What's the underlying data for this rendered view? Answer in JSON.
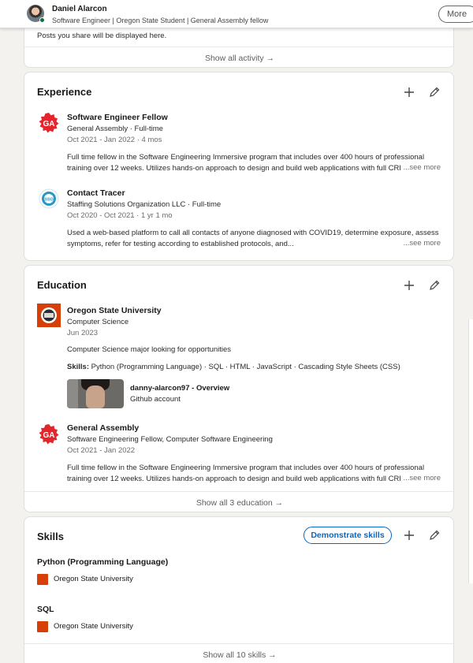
{
  "header": {
    "name": "Daniel Alarcon",
    "headline": "Software Engineer | Oregon State Student | General Assembly fellow",
    "more_label": "More"
  },
  "activity": {
    "empty_text": "Posts you share will be displayed here.",
    "show_all": "Show all activity →"
  },
  "experience": {
    "title": "Experience",
    "items": [
      {
        "title": "Software Engineer Fellow",
        "org": "General Assembly · Full-time",
        "dates": "Oct 2021 - Jan 2022 · 4 mos",
        "desc_line1": "Full time fellow in the Software Engineering Immersive program that includes over 400 hours of professional",
        "desc_line2": "training over 12 weeks. Utilizes hands-on approach to design and build web applications with full CRL",
        "see_more": "...see more"
      },
      {
        "title": "Contact Tracer",
        "org": "Staffing Solutions Organization LLC · Full-time",
        "dates": "Oct 2020 - Oct 2021 · 1 yr 1 mo",
        "desc_line1": "Used a web-based platform to call all contacts of anyone diagnosed with COVID19, determine exposure, assess",
        "desc_line2": "symptoms, refer for testing according to established protocols, and...",
        "see_more": "...see more"
      }
    ]
  },
  "education": {
    "title": "Education",
    "items": [
      {
        "school": "Oregon State University",
        "degree": "Computer Science",
        "dates": "Jun 2023",
        "desc": "Computer Science major looking for opportunities",
        "skills_label": "Skills:",
        "skills": "Python (Programming Language) · SQL · HTML · JavaScript · Cascading Style Sheets (CSS)",
        "media_title": "danny-alarcon97 - Overview",
        "media_sub": "Github account"
      },
      {
        "school": "General Assembly",
        "degree": "Software Engineering Fellow, Computer Software Engineering",
        "dates": "Oct 2021 - Jan 2022",
        "desc_line1": "Full time fellow in the Software Engineering Immersive program that includes over 400 hours of professional",
        "desc_line2": "training over 12 weeks. Utilizes hands-on approach to design and build web applications with full CRL",
        "see_more": "...see more"
      }
    ],
    "show_all": "Show all 3 education →"
  },
  "skills": {
    "title": "Skills",
    "demonstrate_label": "Demonstrate skills",
    "items": [
      {
        "name": "Python (Programming Language)",
        "source": "Oregon State University"
      },
      {
        "name": "SQL",
        "source": "Oregon State University"
      }
    ],
    "show_all": "Show all 10 skills →"
  },
  "logos": {
    "ga_text": "GA",
    "ssc_text": "SSO"
  },
  "colors": {
    "ga_red": "#e4262c",
    "osu_orange": "#d73f09",
    "link_blue": "#0a66c2"
  },
  "icons": [
    "add-icon",
    "edit-pencil-icon",
    "ga-logo",
    "ssc-logo",
    "osu-logo"
  ]
}
